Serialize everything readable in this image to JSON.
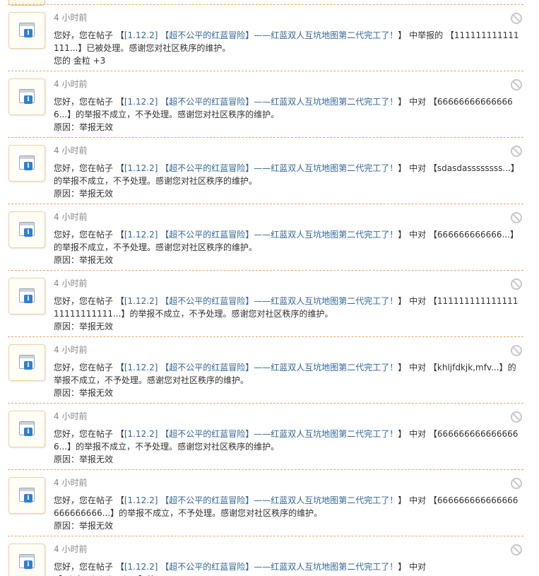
{
  "notifications": [
    {
      "time": "4 小时前",
      "prefix": "您好，您在帖子",
      "link_version": "[1.12.2]",
      "link_title": "【超不公平的红蓝冒险】——红蓝双人互坑地图第二代完工了！",
      "middle": "中举报的",
      "target": "【111111111111111...】",
      "suffix": "已被处理。感谢您对社区秩序的维护。",
      "sub": "您的 金粒 +3"
    },
    {
      "time": "4 小时前",
      "prefix": "您好，您在帖子",
      "link_version": "[1.12.2]",
      "link_title": "【超不公平的红蓝冒险】——红蓝双人互坑地图第二代完工了！",
      "middle": "中对",
      "target": "【666666666666666...】",
      "suffix": "的举报不成立，不予处理。感谢您对社区秩序的维护。",
      "sub": "原因：举报无效"
    },
    {
      "time": "4 小时前",
      "prefix": "您好，您在帖子",
      "link_version": "[1.12.2]",
      "link_title": "【超不公平的红蓝冒险】——红蓝双人互坑地图第二代完工了！",
      "middle": "中对",
      "target": "【sdasdassssssss...】",
      "suffix": "的举报不成立，不予处理。感谢您对社区秩序的维护。",
      "sub": "原因：举报无效"
    },
    {
      "time": "4 小时前",
      "prefix": "您好，您在帖子",
      "link_version": "[1.12.2]",
      "link_title": "【超不公平的红蓝冒险】——红蓝双人互坑地图第二代完工了！",
      "middle": "中对",
      "target": "【666666666666...】",
      "suffix": "的举报不成立，不予处理。感谢您对社区秩序的维护。",
      "sub": "原因：举报无效"
    },
    {
      "time": "4 小时前",
      "prefix": "您好，您在帖子",
      "link_version": "[1.12.2]",
      "link_title": "【超不公平的红蓝冒险】——红蓝双人互坑地图第二代完工了！",
      "middle": "中对",
      "target": "【11111111111111111111111111...】",
      "suffix": "的举报不成立，不予处理。感谢您对社区秩序的维护。",
      "sub": "原因：举报无效"
    },
    {
      "time": "4 小时前",
      "prefix": "您好，您在帖子",
      "link_version": "[1.12.2]",
      "link_title": "【超不公平的红蓝冒险】——红蓝双人互坑地图第二代完工了！",
      "middle": "中对",
      "target": "【khljfdkjk,mfv...】",
      "suffix": "的举报不成立，不予处理。感谢您对社区秩序的维护。",
      "sub": "原因：举报无效"
    },
    {
      "time": "4 小时前",
      "prefix": "您好，您在帖子",
      "link_version": "[1.12.2]",
      "link_title": "【超不公平的红蓝冒险】——红蓝双人互坑地图第二代完工了！",
      "middle": "中对",
      "target": "【6666666666666666...】",
      "suffix": "的举报不成立，不予处理。感谢您对社区秩序的维护。",
      "sub": "原因：举报无效"
    },
    {
      "time": "4 小时前",
      "prefix": "您好，您在帖子",
      "link_version": "[1.12.2]",
      "link_title": "【超不公平的红蓝冒险】——红蓝双人互坑地图第二代完工了！",
      "middle": "中对",
      "target": "【666666666666666666666666...】",
      "suffix": "的举报不成立，不予处理。感谢您对社区秩序的维护。",
      "sub": "原因：举报无效"
    },
    {
      "time": "4 小时前",
      "prefix": "您好，您在帖子",
      "link_version": "[1.12.2]",
      "link_title": "【超不公平的红蓝冒险】——红蓝双人互坑地图第二代完工了！",
      "middle": "中对",
      "target": "【sdsfsgdghdsgds...】",
      "suffix": "的",
      "sub": ""
    }
  ]
}
